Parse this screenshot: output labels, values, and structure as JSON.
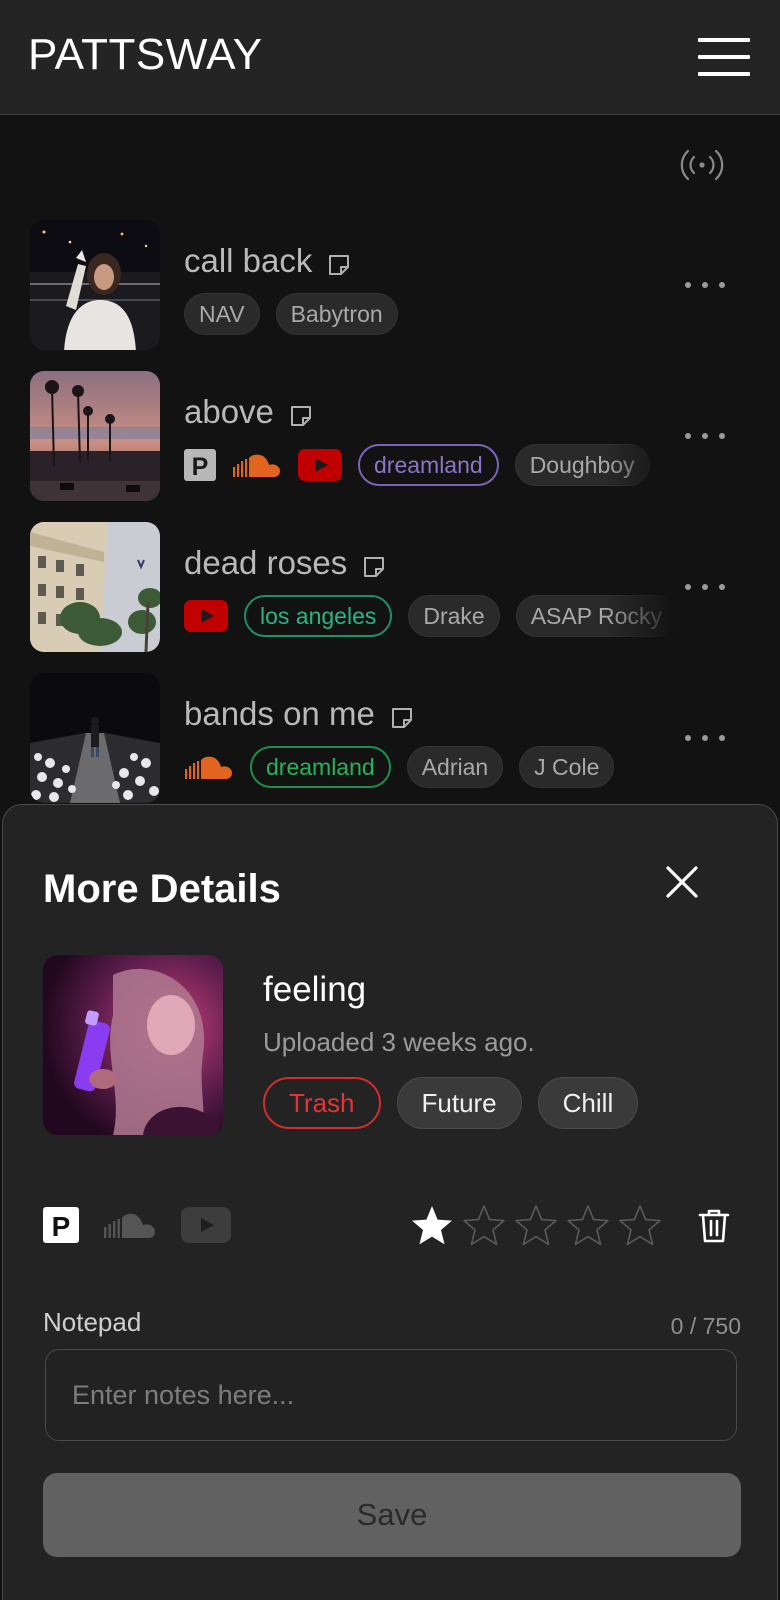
{
  "app": {
    "brand": "PATTSWAY"
  },
  "icons": {
    "menu": "hamburger-icon",
    "broadcast": "broadcast-icon",
    "note": "note-icon",
    "more": "more-icon",
    "close": "close-icon",
    "trash": "trash-icon",
    "star": "star-icon"
  },
  "colors": {
    "background": "#121212",
    "header": "#242424",
    "sheet": "#232323",
    "tag_purple": "#8d74c8",
    "tag_teal": "#2bb585",
    "tag_green": "#27b35c",
    "tag_red": "#e23535",
    "youtube": "#cc0000",
    "soundcloud": "#f26f23"
  },
  "tracks": [
    {
      "title": "call back",
      "tags": [
        "NAV",
        "Babytron"
      ]
    },
    {
      "title": "above",
      "services": [
        "pandora-icon",
        "soundcloud-icon",
        "youtube-icon"
      ],
      "tags": [
        "dreamland",
        "Doughboy"
      ]
    },
    {
      "title": "dead roses",
      "services": [
        "youtube-icon"
      ],
      "tags": [
        "los angeles",
        "Drake",
        "ASAP Rocky"
      ]
    },
    {
      "title": "bands on me",
      "services": [
        "soundcloud-icon"
      ],
      "tags": [
        "dreamland",
        "Adrian",
        "J Cole"
      ]
    }
  ],
  "details": {
    "heading": "More Details",
    "title": "feeling",
    "uploaded": "Uploaded 3 weeks ago.",
    "tags": [
      "Trash",
      "Future",
      "Chill"
    ],
    "services": [
      "pandora-icon",
      "soundcloud-icon",
      "youtube-icon"
    ],
    "rating": 1,
    "rating_max": 5,
    "notepad": {
      "label": "Notepad",
      "count": "0 / 750",
      "placeholder": "Enter notes here...",
      "value": ""
    },
    "save_label": "Save"
  }
}
